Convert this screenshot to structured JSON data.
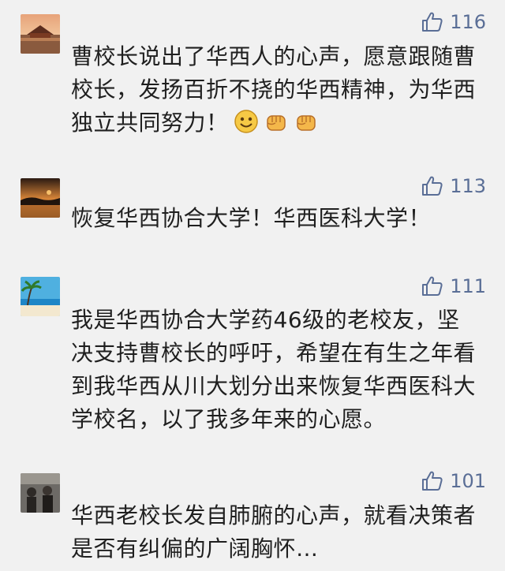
{
  "comments": [
    {
      "likes": "116",
      "text": "曹校长说出了华西人的心声，愿意跟随曹校长，发扬百折不挠的华西精神，为华西独立共同努力！",
      "emojis": [
        "smile-emoji",
        "fist-emoji",
        "fist-emoji"
      ]
    },
    {
      "likes": "113",
      "text": "恢复华西协合大学！华西医科大学！"
    },
    {
      "likes": "111",
      "text": "我是华西协合大学药46级的老校友，坚决支持曹校长的呼吁，希望在有生之年看到我华西从川大划分出来恢复华西医科大学校名，以了我多年来的心愿。"
    },
    {
      "likes": "101",
      "text": "华西老校长发自肺腑的心声，就看决策者是否有纠偏的广阔胸怀…"
    }
  ],
  "colors": {
    "background": "#f1f1f1",
    "text": "#1f1f1f",
    "like": "#5a6e96"
  }
}
